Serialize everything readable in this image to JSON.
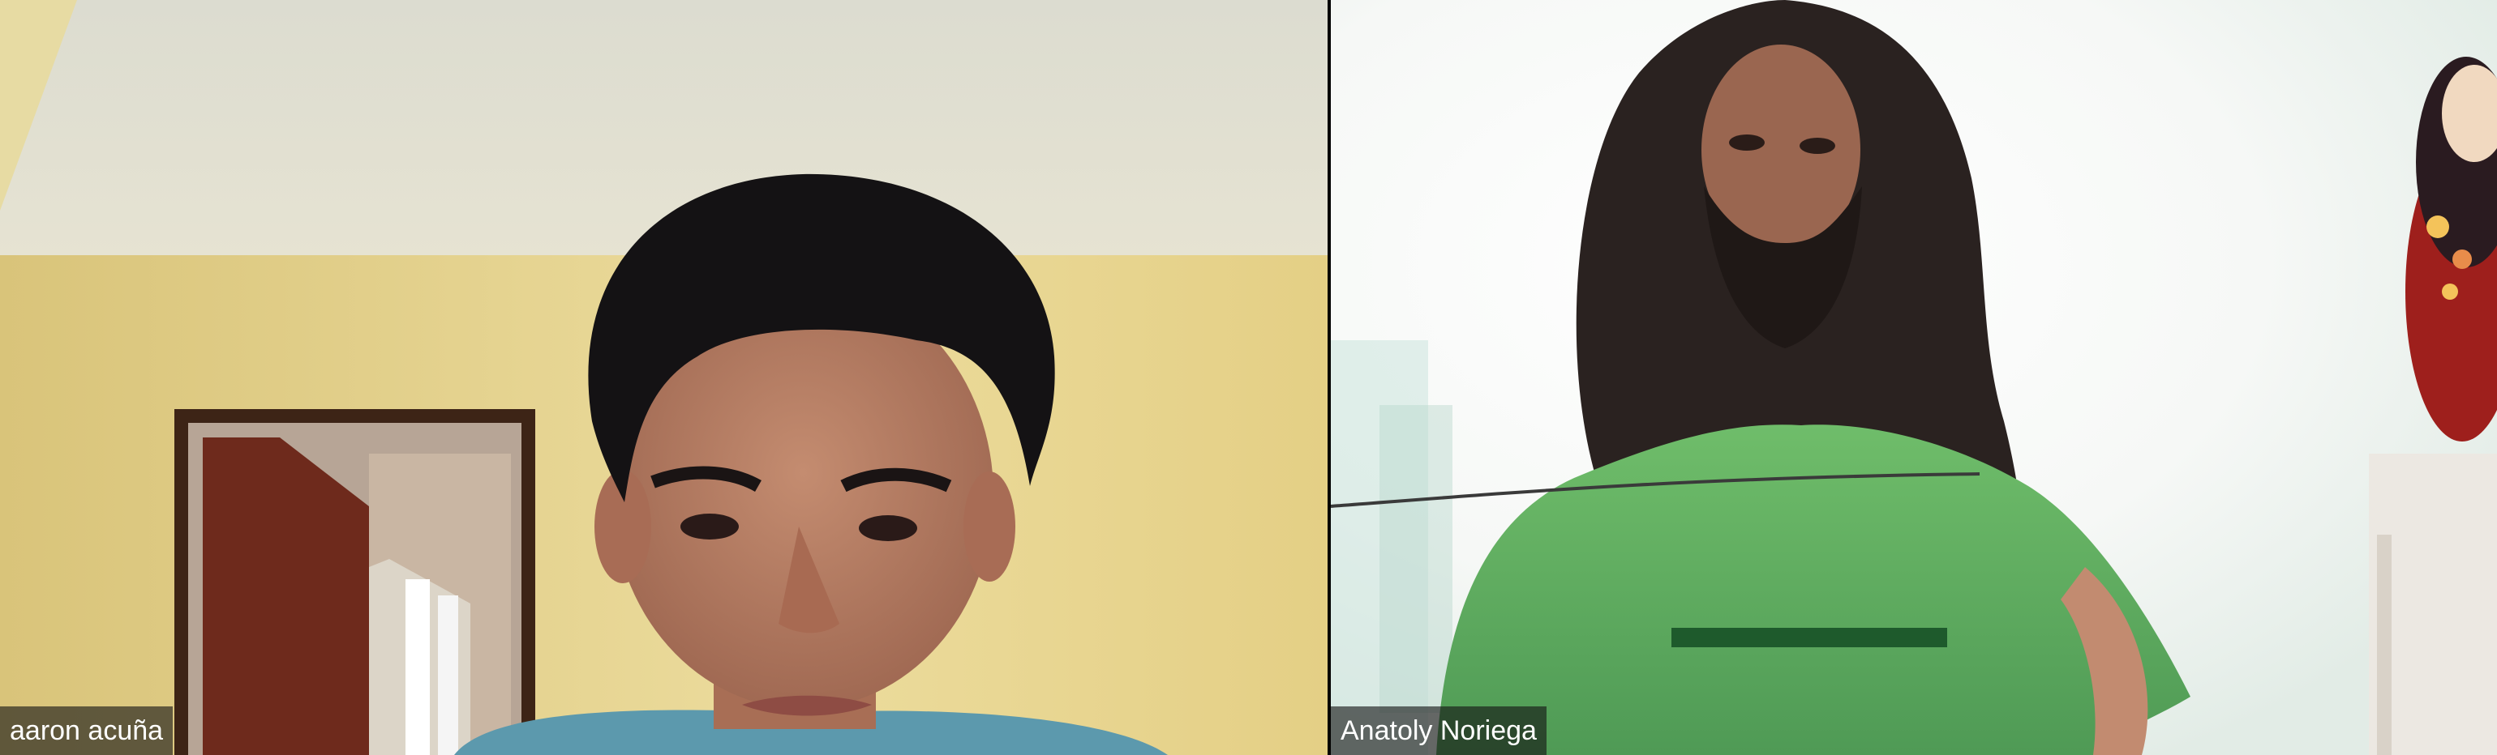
{
  "app": {
    "view": "gallery"
  },
  "participants": [
    {
      "name": "aaron acuña",
      "video": "on",
      "scene": "person-in-room-with-doorway"
    },
    {
      "name": "Anatoly Noriega",
      "video": "on",
      "scene": "person-in-green-shirt-bright-backlight"
    }
  ],
  "colors": {
    "label_background": "#141414",
    "label_text": "#ffffff",
    "gallery_background": "#000000",
    "wall_left": "#e8d692",
    "shirt_right": "#5fae5f"
  }
}
